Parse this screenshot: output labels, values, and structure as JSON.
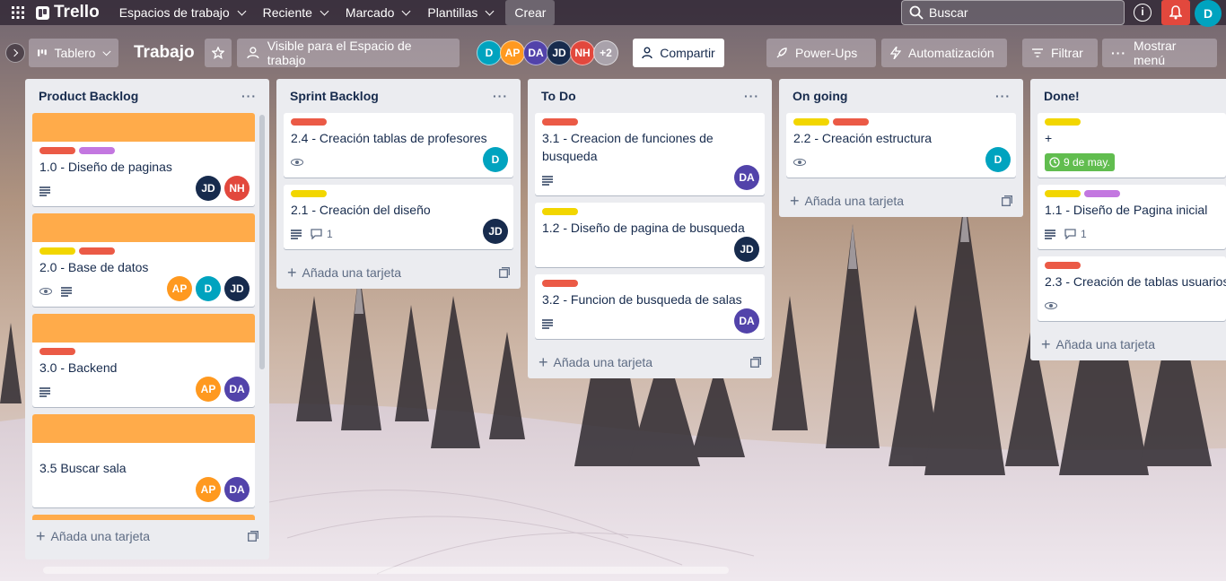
{
  "header": {
    "brand": "Trello",
    "nav": [
      "Espacios de trabajo",
      "Reciente",
      "Marcado",
      "Plantillas"
    ],
    "create": "Crear",
    "search_placeholder": "Buscar",
    "user_initial": "D"
  },
  "board": {
    "view": "Tablero",
    "title": "Trabajo",
    "visibility": "Visible para el Espacio de trabajo",
    "members": [
      {
        "initials": "D",
        "color": "#00a3bf"
      },
      {
        "initials": "AP",
        "color": "#ff991f"
      },
      {
        "initials": "DA",
        "color": "#5243aa"
      },
      {
        "initials": "JD",
        "color": "#172b4d"
      },
      {
        "initials": "NH",
        "color": "#e2483d"
      }
    ],
    "more_members": "+2",
    "share": "Compartir",
    "powerups": "Power-Ups",
    "automation": "Automatización",
    "filter": "Filtrar",
    "menu": "Mostrar menú"
  },
  "add_card": "Añada una tarjeta",
  "colors": {
    "red": "#eb5a46",
    "yellow": "#f2d600",
    "purple": "#c377e0",
    "orange_cover": "#ffab4a",
    "green_due": "#61bd4f"
  },
  "lists": [
    {
      "name": "Product Backlog",
      "cards": [
        {
          "cover": true,
          "labels": [
            "red",
            "purple"
          ],
          "title": "1.0 - Diseño de paginas",
          "desc": true,
          "members": [
            "JD",
            "NH"
          ]
        },
        {
          "cover": true,
          "labels": [
            "yellow",
            "red"
          ],
          "title": "2.0 - Base de datos",
          "watch": true,
          "desc": true,
          "members": [
            "AP",
            "D",
            "JD"
          ]
        },
        {
          "cover": true,
          "labels": [
            "red"
          ],
          "title": "3.0 - Backend",
          "desc": true,
          "members": [
            "AP",
            "DA"
          ]
        },
        {
          "cover": true,
          "labels": [],
          "title": "3.5 Buscar sala",
          "members": [
            "AP",
            "DA"
          ]
        }
      ]
    },
    {
      "name": "Sprint Backlog",
      "cards": [
        {
          "labels": [
            "red"
          ],
          "title": "2.4 - Creación tablas de profesores",
          "watch": true,
          "members": [
            "D"
          ]
        },
        {
          "labels": [
            "yellow"
          ],
          "title": "2.1 - Creación del diseño",
          "desc": true,
          "comments": "1",
          "members": [
            "JD"
          ]
        }
      ]
    },
    {
      "name": "To Do",
      "cards": [
        {
          "labels": [
            "red"
          ],
          "title": "3.1 - Creacion de funciones de busqueda",
          "desc": true,
          "members": [
            "DA"
          ]
        },
        {
          "labels": [
            "yellow"
          ],
          "title": "1.2 - Diseño de pagina de busqueda",
          "members": [
            "JD"
          ]
        },
        {
          "labels": [
            "red"
          ],
          "title": "3.2 - Funcion de busqueda de salas",
          "desc": true,
          "members": [
            "DA"
          ]
        }
      ]
    },
    {
      "name": "On going",
      "cards": [
        {
          "labels": [
            "yellow",
            "red"
          ],
          "title": "2.2 - Creación estructura",
          "watch": true,
          "members": [
            "D"
          ]
        }
      ]
    },
    {
      "name": "Done!",
      "cards": [
        {
          "labels": [
            "yellow"
          ],
          "title": "+",
          "due": "9 de may.",
          "members": []
        },
        {
          "labels": [
            "yellow",
            "purple"
          ],
          "title": "1.1 - Diseño de Pagina inicial",
          "desc": true,
          "comments": "1",
          "members": []
        },
        {
          "labels": [
            "red"
          ],
          "title": "2.3 - Creación de tablas usuarios",
          "watch": true,
          "members": []
        }
      ]
    }
  ]
}
